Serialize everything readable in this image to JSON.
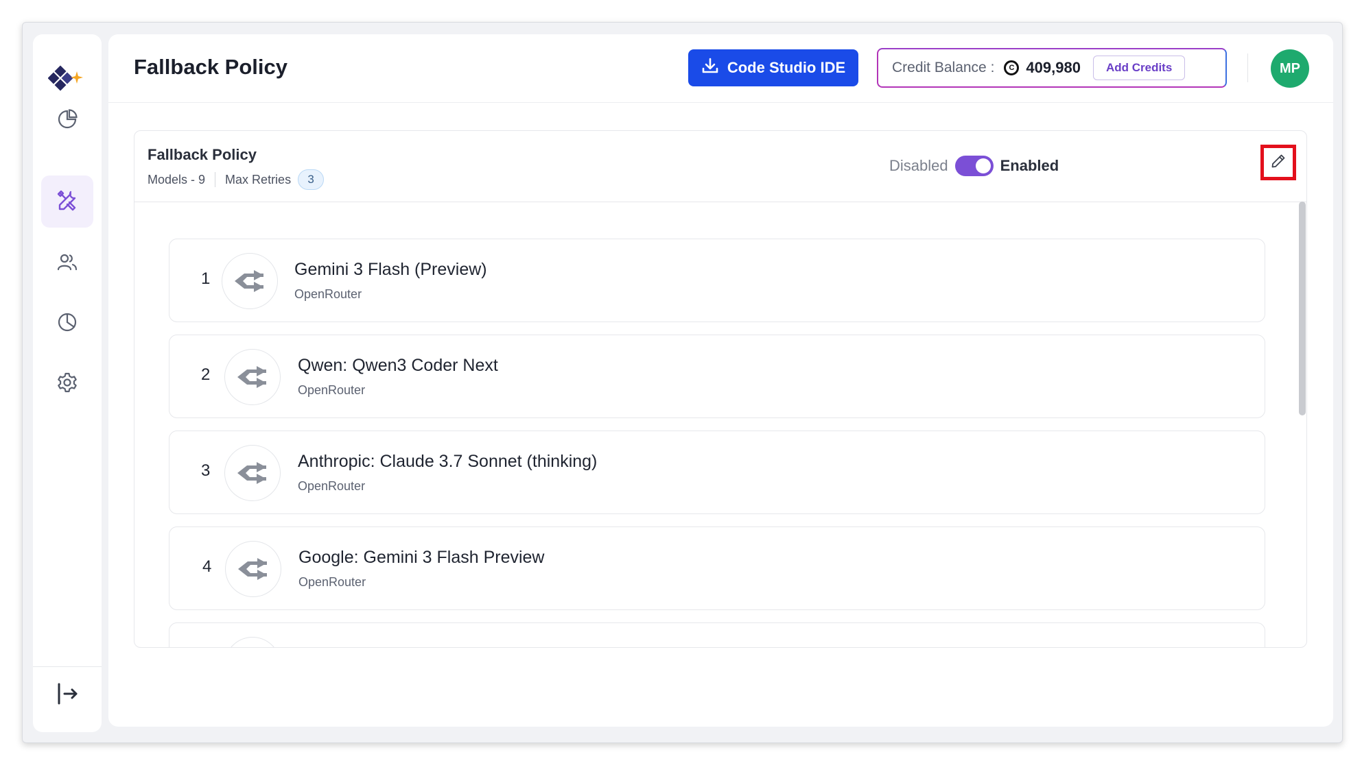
{
  "header": {
    "title": "Fallback Policy",
    "ide_button_label": "Code Studio IDE",
    "credit_label": "Credit Balance :",
    "credit_value": "409,980",
    "add_credits_label": "Add Credits",
    "avatar_initials": "MP"
  },
  "sidebar": {
    "items": [
      {
        "icon": "pie-chart-icon"
      },
      {
        "icon": "tools-icon",
        "active": true
      },
      {
        "icon": "users-icon"
      },
      {
        "icon": "analytics-icon"
      },
      {
        "icon": "gear-icon"
      }
    ],
    "logout_icon": "logout-icon"
  },
  "policy": {
    "title": "Fallback Policy",
    "models_label": "Models - 9",
    "max_retries_label": "Max Retries",
    "max_retries_value": "3",
    "toggle_off_label": "Disabled",
    "toggle_on_label": "Enabled",
    "enabled": true
  },
  "models": [
    {
      "index": "1",
      "name": "Gemini 3 Flash (Preview)",
      "provider": "OpenRouter"
    },
    {
      "index": "2",
      "name": "Qwen: Qwen3 Coder Next",
      "provider": "OpenRouter"
    },
    {
      "index": "3",
      "name": "Anthropic: Claude 3.7 Sonnet (thinking)",
      "provider": "OpenRouter"
    },
    {
      "index": "4",
      "name": "Google: Gemini 3 Flash Preview",
      "provider": "OpenRouter"
    }
  ],
  "colors": {
    "accent": "#7b4fd6",
    "primary_button": "#1a4be8",
    "avatar": "#1eaa6e",
    "highlight": "#e3101c"
  }
}
